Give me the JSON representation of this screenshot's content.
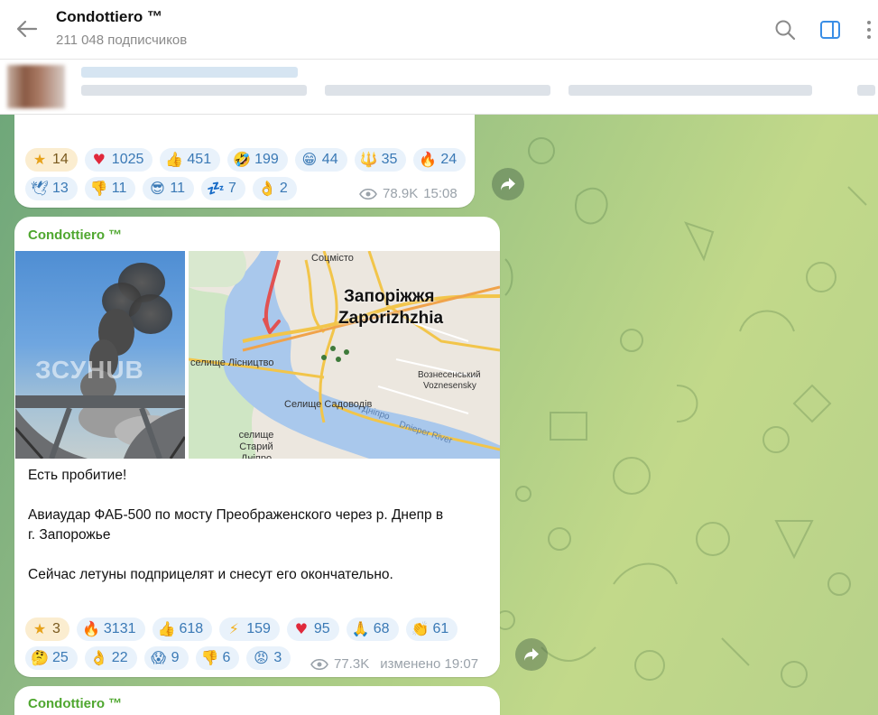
{
  "header": {
    "title": "Condottiero ™",
    "subscribers": "211 048 подписчиков"
  },
  "post1": {
    "reactions": [
      {
        "icon": "★",
        "count": "14",
        "kind": "star"
      },
      {
        "icon": "♥",
        "count": "1025",
        "kind": "heart"
      },
      {
        "icon": "👍",
        "count": "451",
        "kind": "thumbs-up"
      },
      {
        "icon": "🤣",
        "count": "199",
        "kind": "rofl"
      },
      {
        "icon": "😁",
        "count": "44",
        "kind": "grin"
      },
      {
        "icon": "🔱",
        "count": "35",
        "kind": "trident"
      },
      {
        "icon": "🔥",
        "count": "24",
        "kind": "fire"
      },
      {
        "icon": "🕊",
        "count": "13",
        "kind": "dove"
      },
      {
        "icon": "👎",
        "count": "11",
        "kind": "thumbs-down"
      },
      {
        "icon": "😎",
        "count": "11",
        "kind": "cool"
      },
      {
        "icon": "💤",
        "count": "7",
        "kind": "zzz"
      },
      {
        "icon": "👌",
        "count": "2",
        "kind": "ok"
      }
    ],
    "views": "78.9K",
    "time": "15:08"
  },
  "post2": {
    "author": "Condottiero ™",
    "photo1_watermark": "ЗСУHUB",
    "map": {
      "city_ua": "Запоріжжя",
      "city_en": "Zaporizhzhia",
      "sotsmisto": "Соцмісто",
      "lisnychtvo": "селище Лісництво",
      "sadovod": "Селище Садоводів",
      "stary_dnipro": "селище Старий Дніпро",
      "voznesenskyi_ua": "Вознесенський",
      "voznesenskyi_en": "Voznesensky",
      "dnipro_ua": "Дніпро",
      "dnipro_en": "Dnieper River"
    },
    "text": [
      "Есть пробитие!",
      "Авиаудар ФАБ-500 по мосту Преображенского через р. Днепр в",
      "г. Запорожье",
      "Сейчас летуны подприцелят и снесут его окончательно."
    ],
    "reactions": [
      {
        "icon": "★",
        "count": "3",
        "kind": "star"
      },
      {
        "icon": "🔥",
        "count": "3131",
        "kind": "fire"
      },
      {
        "icon": "👍",
        "count": "618",
        "kind": "thumbs-up"
      },
      {
        "icon": "⚡",
        "count": "159",
        "kind": "lightning"
      },
      {
        "icon": "♥",
        "count": "95",
        "kind": "heart"
      },
      {
        "icon": "🙏",
        "count": "68",
        "kind": "pray"
      },
      {
        "icon": "👏",
        "count": "61",
        "kind": "clap"
      },
      {
        "icon": "🤔",
        "count": "25",
        "kind": "thinking"
      },
      {
        "icon": "👌",
        "count": "22",
        "kind": "ok"
      },
      {
        "icon": "😱",
        "count": "9",
        "kind": "scream"
      },
      {
        "icon": "👎",
        "count": "6",
        "kind": "thumbs-down"
      },
      {
        "icon": "😡",
        "count": "3",
        "kind": "angry"
      }
    ],
    "views": "77.3K",
    "time": "изменено 19:07"
  },
  "post3": {
    "author": "Condottiero ™"
  },
  "colors": {
    "accent": "#3a79b5",
    "author": "#4fa72f",
    "pill_bg": "#e9f2fb",
    "star_pill_bg": "#fbedd0"
  }
}
